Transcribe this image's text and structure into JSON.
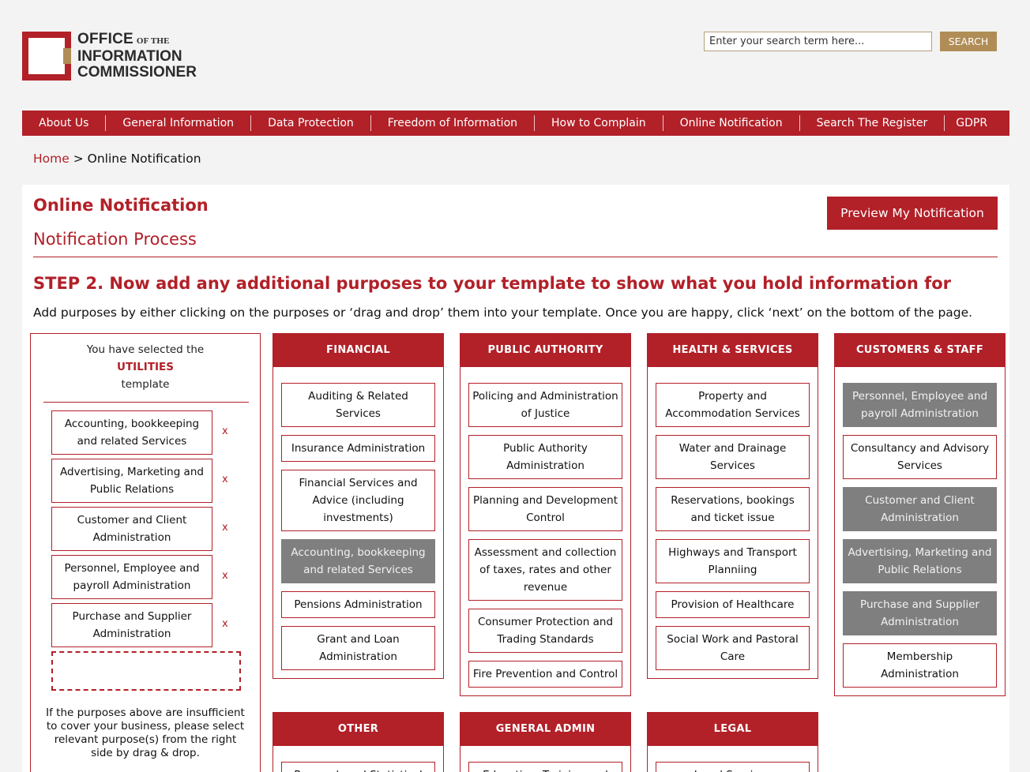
{
  "header": {
    "logo": {
      "line1": "OFFICE",
      "line1_small": "OF THE",
      "line2": "INFORMATION",
      "line3": "COMMISSIONER"
    },
    "search": {
      "placeholder": "Enter your search term here...",
      "button": "SEARCH"
    }
  },
  "nav": [
    "About Us",
    "General Information",
    "Data Protection",
    "Freedom of Information",
    "How to Complain",
    "Online Notification",
    "Search The Register",
    "GDPR"
  ],
  "breadcrumb": {
    "home": "Home",
    "separator": ">",
    "current": "Online Notification"
  },
  "main": {
    "title": "Online Notification",
    "preview_button": "Preview My Notification",
    "subtitle": "Notification Process",
    "step_title": "STEP 2. Now add any additional purposes to your template to show what you hold information for",
    "step_desc": "Add purposes by either clicking on the purposes or ‘drag and drop’ them into your template. Once you are happy, click ‘next’ on the bottom of the page."
  },
  "template": {
    "intro": "You have selected the",
    "name": "UTILITIES",
    "suffix": "template",
    "remove_label": "x",
    "items": [
      "Accounting, bookkeeping and related Services",
      "Advertising, Marketing and Public Relations",
      "Customer and Client Administration",
      "Personnel, Employee and payroll Administration",
      "Purchase and Supplier Administration"
    ],
    "note": "If the purposes above are insufficient to cover your business, please select relevant purpose(s) from the right side by drag & drop."
  },
  "categories": [
    {
      "title": "FINANCIAL",
      "items": [
        {
          "label": "Auditing & Related Services",
          "selected": false
        },
        {
          "label": "Insurance Administration",
          "selected": false
        },
        {
          "label": "Financial Services and Advice (including investments)",
          "selected": false
        },
        {
          "label": "Accounting, bookkeeping and related Services",
          "selected": true
        },
        {
          "label": "Pensions Administration",
          "selected": false
        },
        {
          "label": "Grant and Loan Administration",
          "selected": false
        }
      ]
    },
    {
      "title": "PUBLIC AUTHORITY",
      "items": [
        {
          "label": "Policing and Administration of Justice",
          "selected": false
        },
        {
          "label": "Public Authority Administration",
          "selected": false
        },
        {
          "label": "Planning and Development Control",
          "selected": false
        },
        {
          "label": "Assessment and collection of taxes, rates and other revenue",
          "selected": false
        },
        {
          "label": "Consumer Protection and Trading Standards",
          "selected": false
        },
        {
          "label": "Fire Prevention and Control",
          "selected": false
        }
      ]
    },
    {
      "title": "HEALTH & SERVICES",
      "items": [
        {
          "label": "Property and Accommodation Services",
          "selected": false
        },
        {
          "label": "Water and Drainage Services",
          "selected": false
        },
        {
          "label": "Reservations, bookings and ticket issue",
          "selected": false
        },
        {
          "label": "Highways and Transport Planniing",
          "selected": false
        },
        {
          "label": "Provision of Healthcare",
          "selected": false
        },
        {
          "label": "Social Work and Pastoral Care",
          "selected": false
        }
      ]
    },
    {
      "title": "CUSTOMERS & STAFF",
      "items": [
        {
          "label": "Personnel, Employee and payroll Administration",
          "selected": true
        },
        {
          "label": "Consultancy and Advisory Services",
          "selected": false
        },
        {
          "label": "Customer and Client Administration",
          "selected": true
        },
        {
          "label": "Advertising, Marketing and Public Relations",
          "selected": true
        },
        {
          "label": "Purchase and Supplier Administration",
          "selected": true
        },
        {
          "label": "Membership Administration",
          "selected": false
        }
      ]
    },
    {
      "title": "OTHER",
      "items": [
        {
          "label": "Research and Statistical",
          "selected": false
        }
      ]
    },
    {
      "title": "GENERAL ADMIN",
      "items": [
        {
          "label": "Education, Training and",
          "selected": false
        }
      ]
    },
    {
      "title": "LEGAL",
      "items": [
        {
          "label": "Legal Services",
          "selected": false
        }
      ]
    }
  ]
}
